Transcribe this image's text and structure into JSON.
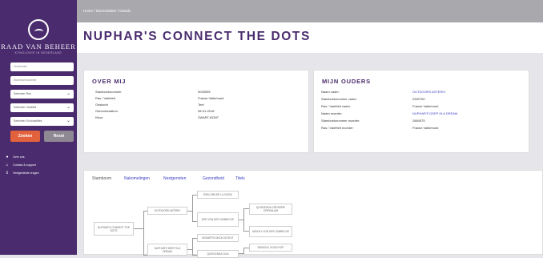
{
  "sidebar": {
    "logo_name": "RAAD VAN BEHEER",
    "logo_sub": "KYNOLOGIE IN NEDERLAND",
    "search_name_placeholder": "Hondnaam",
    "search_number_placeholder": "Stamboeknummer",
    "select_breed": "Selecteer Ras",
    "select_variety": "Selecteer Variëteit",
    "select_gender": "Selecteer Geslacht",
    "select_color": "Selecteer Schouwtitles",
    "btn_zoeken": "Zoeken",
    "btn_reset": "Reset",
    "links": [
      {
        "icon": "paw-icon",
        "label": "Over ons"
      },
      {
        "icon": "house-icon",
        "label": "Contact & support"
      },
      {
        "icon": "info-icon",
        "label": "Veelgestelde vragen"
      }
    ]
  },
  "header": {
    "breadcrumb": "Home  /  Dierendokter  /  Details",
    "title": "NUPHAR'S CONNECT THE DOTS"
  },
  "over_mij": {
    "heading": "OVER MIJ",
    "rows": [
      {
        "label": "Stamboeknummer",
        "value": "3030595"
      },
      {
        "label": "Ras / Variëteit",
        "value": "Franse Vallerhond"
      },
      {
        "label": "Geslacht",
        "value": "Teef"
      },
      {
        "label": "Geboortedatum",
        "value": "08-01-2018"
      },
      {
        "label": "Kleur",
        "value": "ZWART-BONT"
      }
    ]
  },
  "mijn_ouders": {
    "heading": "MIJN OUDERS",
    "rows": [
      {
        "label": "Naam vader:",
        "value": "OUTDOORS ASTERIX",
        "link": true
      },
      {
        "label": "Stamboeknummer vader:",
        "value": "2900750",
        "link": false
      },
      {
        "label": "Ras / Variëteit vader:",
        "value": "Franse Vallerhond",
        "link": false
      },
      {
        "label": "Naam moeder:",
        "value": "NUPHAR'S DEEP IN A DREAM",
        "link": true
      },
      {
        "label": "Stamboeknummer moeder:",
        "value": "2884575",
        "link": false
      },
      {
        "label": "Ras / Variëteit moeder:",
        "value": "Franse Vallerhond",
        "link": false
      }
    ]
  },
  "tabs": [
    "Stamboom",
    "Nakomelingen",
    "Nestgenoten",
    "Gezondheid",
    "Titels"
  ],
  "pedigree": {
    "self": "NUPHAR'S CONNECT THE DOTS",
    "father": "OUTDOORS ASTERIX",
    "mother": "NUPHAR'S DEEP IN A DREAM",
    "ff": "ESKLORA DE LA CURIU",
    "fm": "DEE VON DER LEMBECKE",
    "fmf": "QUISCENDA CROSSPIE ORPHALAM",
    "fmm": "ASHLEY VON DER LEMBECKE",
    "mf": "NOVARTIS DEZA OUTDOT",
    "mm": "QUISCENDA GLIA",
    "mmf": "BONGOLI GOOD POP"
  }
}
